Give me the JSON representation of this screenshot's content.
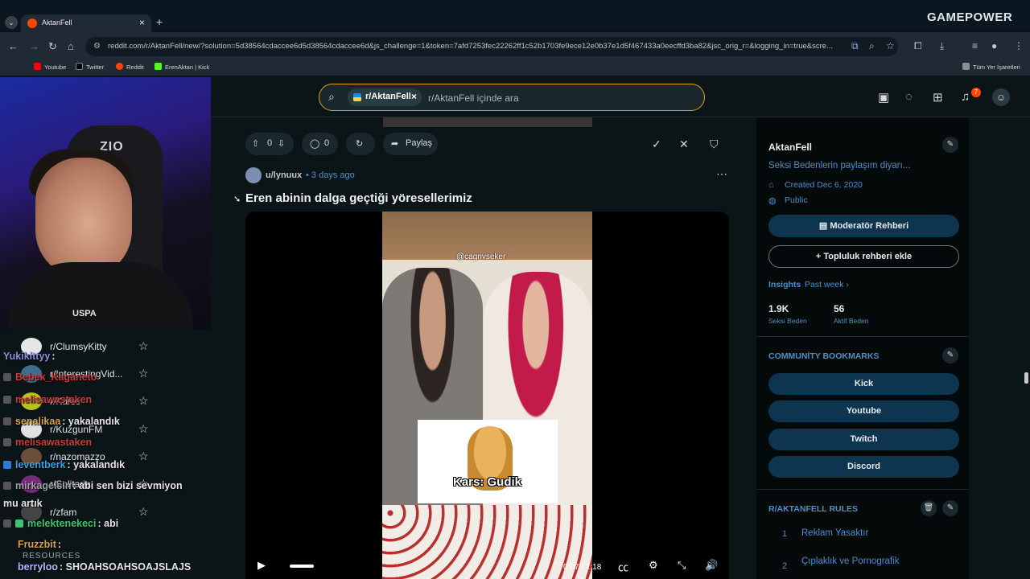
{
  "browser": {
    "tab_title": "AktanFell",
    "url": "reddit.com/r/AktanFell/new/?solution=5d38564cdaccee6d5d38564cdaccee6d&js_challenge=1&token=7afd7253fec22262ff1c52b1703fe9ece12e0b37e1d5f467433a0eecffd3ba82&jsc_orig_r=&logging_in=true&scre...",
    "bookmarks": [
      "Youtube",
      "Twitter",
      "Reddit",
      "ErenAktan | Kick"
    ],
    "all_bookmarks_label": "Tüm Yer İşaretleri",
    "new_tab_label": "+"
  },
  "overlay": {
    "brand_logo": "GAMEPOWER",
    "chair_logo": "ZIO",
    "shirt_text": "USPA"
  },
  "left_sidebar": {
    "communities": [
      {
        "name": "r/ClumsyKitty"
      },
      {
        "name": "r/InterestingVid..."
      },
      {
        "name": "r/Kafes"
      },
      {
        "name": "r/KuzgunFM"
      },
      {
        "name": "r/nazomazzo"
      },
      {
        "name": "r/Solitaria"
      },
      {
        "name": "r/zfam"
      }
    ],
    "resources_label": "RESOURCES"
  },
  "stream_chat": [
    {
      "user": "Yukikittyy",
      "msg": ":",
      "color": "#8a8fd9"
    },
    {
      "user": "Bebek_Kaganeto",
      "msg": "",
      "color": "#c93b3b"
    },
    {
      "user": "melisawastaken",
      "msg": "",
      "color": "#c93b3b"
    },
    {
      "user": "senalikaa",
      "msg": ": yakalandık",
      "color": "#d6a24a"
    },
    {
      "user": "melisawastaken",
      "msg": "",
      "color": "#c93b3b"
    },
    {
      "user": "leventberk",
      "msg": ": yakalandık",
      "color": "#3aa0e0"
    },
    {
      "user": "mirkagelsin",
      "msg": ": abi sen bizi sevmiyon",
      "color": "#9aa0a6"
    },
    {
      "user": "",
      "msg": "mu artık",
      "color": "#e6e6e6"
    },
    {
      "user": "melektenekeci",
      "msg": ": abi",
      "color": "#3ec46d"
    },
    {
      "user": "Fruzzbit",
      "msg": ":",
      "color": "#d6a24a"
    },
    {
      "user": "berryloo",
      "msg": ": SHOAHSOAHSOAJSLAJS",
      "color": "#b4b9ff"
    }
  ],
  "header": {
    "search_chip": "r/AktanFell",
    "search_placeholder": "r/AktanFell içinde ara",
    "notification_count": "7",
    "icons": [
      "advertise-icon",
      "chat-icon",
      "create-icon",
      "bell-icon",
      "avatar"
    ]
  },
  "prev_post_actions": {
    "upvotes": "0",
    "comments": "0",
    "share_label": "Paylaş"
  },
  "post": {
    "author": "u/lynuux",
    "time": "• 3 days ago",
    "title": "Eren abinin dalga geçtiği yöresellerimiz",
    "video": {
      "watermark": "@cagrivseker",
      "caption": "Kars: Gudik",
      "time": "0:07 / 1:18"
    }
  },
  "sidebar": {
    "community_name": "AktanFell",
    "description": "Seksi Bedenlerin paylaşım diyarı...",
    "created": "Created Dec 6, 2020",
    "visibility": "Public",
    "mod_guide_button": "Moderatör Rehberi",
    "add_guide_button": "+ Topluluk rehberi ekle",
    "insights_label": "Insights",
    "insights_period": "Past week ›",
    "stats": [
      {
        "value": "1.9K",
        "label": "Seksi Beden"
      },
      {
        "value": "56",
        "label": "Aktif Beden"
      }
    ],
    "bookmarks_title": "COMMUNİTY BOOKMARKS",
    "bookmarks": [
      "Kick",
      "Youtube",
      "Twitch",
      "Discord"
    ],
    "rules_title": "R/AKTANFELL RULES",
    "rules": [
      {
        "num": "1",
        "text": "Reklam Yasaktır"
      },
      {
        "num": "2",
        "text": "Çıplaklık ve Pornografik"
      }
    ]
  }
}
